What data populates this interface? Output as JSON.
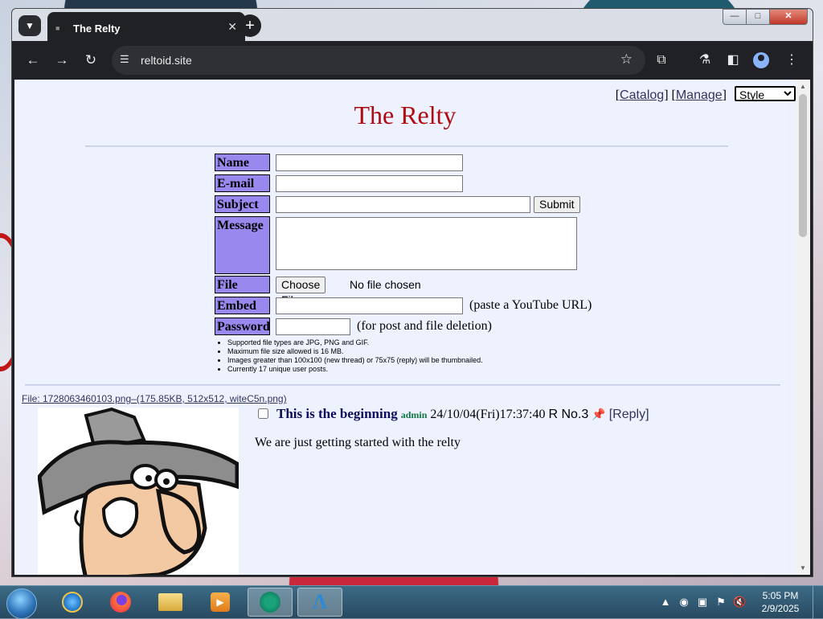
{
  "browser": {
    "tab_title": "The Relty",
    "url": "reltoid.site"
  },
  "page": {
    "admin_links": {
      "open1": "[",
      "catalog": "Catalog",
      "mid": "] [",
      "manage": "Manage",
      "close": "]",
      "style_label": "Style"
    },
    "board_title": "The Relty",
    "form": {
      "name_label": "Name",
      "email_label": "E-mail",
      "subject_label": "Subject",
      "submit_label": "Submit",
      "message_label": "Message",
      "file_label": "File",
      "choose_file_label": "Choose File",
      "no_file_text": "No file chosen",
      "embed_label": "Embed",
      "embed_note": "(paste a YouTube URL)",
      "password_label": "Password",
      "password_note": "(for post and file deletion)"
    },
    "rules": [
      "Supported file types are JPG, PNG and GIF.",
      "Maximum file size allowed is 16 MB.",
      "Images greater than 100x100 (new thread) or 75x75 (reply) will be thumbnailed.",
      "Currently 17 unique user posts."
    ],
    "post": {
      "file_info": "File: 1728063460103.png–(175.85KB, 512x512, witeC5n.png)",
      "subject": "This is the beginning",
      "name": "admin",
      "datetime": "24/10/04(Fri)17:37:40",
      "number": "R No.3",
      "reply_link": "[Reply]",
      "message": "We are just getting started with the relty"
    }
  },
  "taskbar": {
    "time": "5:05 PM",
    "date": "2/9/2025"
  },
  "colors": {
    "title_red": "#af0a0f",
    "label_purple": "#9988ee",
    "page_bg": "#eef2ff",
    "subject_blue": "#0f0c5d",
    "name_green": "#117743"
  }
}
